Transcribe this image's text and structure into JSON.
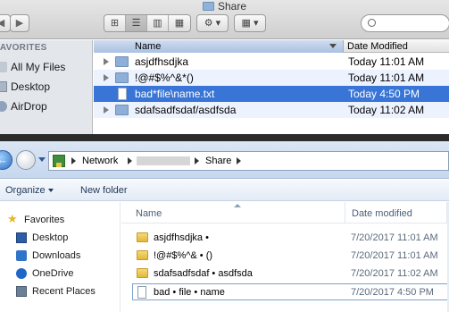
{
  "mac": {
    "title": "Share",
    "nav": {
      "back": "◀",
      "forward": "▶"
    },
    "view_buttons": [
      "⊞",
      "☰",
      "▥",
      "▦"
    ],
    "action_button": "⚙ ▾",
    "arrange_button": "▦ ▾",
    "sidebar": {
      "section": "FAVORITES",
      "items": [
        {
          "label": "All My Files",
          "icon": "all-files-icon"
        },
        {
          "label": "Desktop",
          "icon": "desktop-icon"
        },
        {
          "label": "AirDrop",
          "icon": "airdrop-icon"
        }
      ]
    },
    "columns": {
      "name": "Name",
      "date": "Date Modified"
    },
    "rows": [
      {
        "name": "asjdfhsdjka",
        "date": "Today 11:01 AM",
        "kind": "folder"
      },
      {
        "name": "!@#$%^&*()",
        "date": "Today 11:01 AM",
        "kind": "folder"
      },
      {
        "name": "bad*file\\name.txt",
        "date": "Today 4:50 PM",
        "kind": "file",
        "selected": true
      },
      {
        "name": "sdafsadfsdaf/asdfsda",
        "date": "Today 11:02 AM",
        "kind": "folder"
      }
    ]
  },
  "win": {
    "breadcrumbs": {
      "network": "Network",
      "share": "Share"
    },
    "commands": {
      "organize": "Organize",
      "new_folder": "New folder"
    },
    "nav": {
      "favorites": "Favorites",
      "items": [
        {
          "label": "Desktop",
          "icon": "desktop-icon",
          "color": "#2b5ea7"
        },
        {
          "label": "Downloads",
          "icon": "downloads-icon",
          "color": "#2f74c8"
        },
        {
          "label": "OneDrive",
          "icon": "onedrive-icon",
          "color": "#1e67c8"
        },
        {
          "label": "Recent Places",
          "icon": "recent-places-icon",
          "color": "#6b7f95"
        }
      ]
    },
    "columns": {
      "name": "Name",
      "date": "Date modified"
    },
    "rows": [
      {
        "name": "asjdfhsdjka •",
        "date": "7/20/2017 11:01 AM",
        "kind": "folder"
      },
      {
        "name": "!@#$%^& • ()",
        "date": "7/20/2017 11:01 AM",
        "kind": "folder"
      },
      {
        "name": "sdafsadfsdaf • asdfsda",
        "date": "7/20/2017 11:02 AM",
        "kind": "folder"
      },
      {
        "name": "bad • file • name",
        "date": "7/20/2017 4:50 PM",
        "kind": "file"
      }
    ]
  },
  "colors": {
    "mac_selection": "#3875d7",
    "mac_alt_row": "#edf3fe",
    "win_accent": "#1e395b"
  }
}
